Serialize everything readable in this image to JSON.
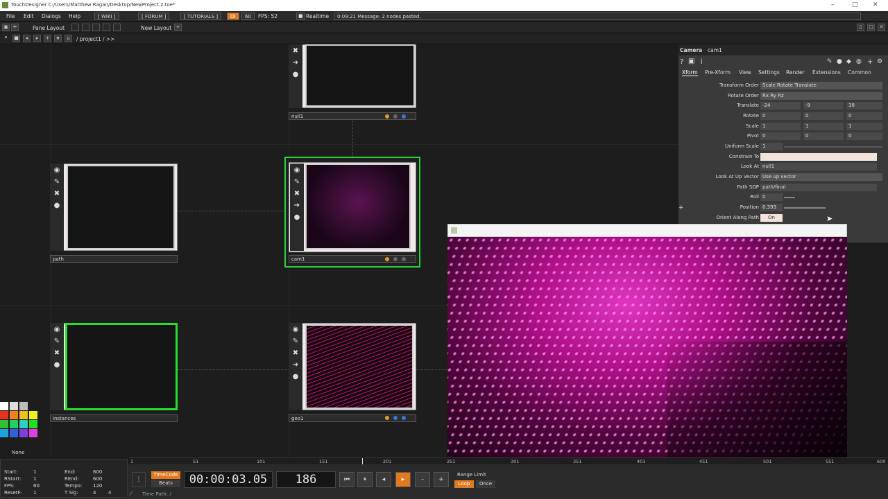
{
  "window": {
    "title": "TouchDesigner C:/Users/Matthew Ragan/Desktop/NewProject.2.toe*",
    "minimize_icon": "minimize-icon",
    "maximize_icon": "maximize-icon",
    "close_icon": "close-icon"
  },
  "menubar": {
    "items": [
      "File",
      "Edit",
      "Dialogs",
      "Help"
    ],
    "wiki": "[ WIKI ]",
    "forum": "[ FORUM ]",
    "tutorials": "[ TUTORIALS ]",
    "oi": "OI",
    "fps_cap": "60",
    "fps": "FPS: 52",
    "realtime": "Realtime",
    "message": "0:09:21 Message: 2 nodes pasted."
  },
  "toolbar": {
    "pane_layout": "Pane Layout",
    "new_layout": "New Layout",
    "path": "/ project1 / >>"
  },
  "nodes": {
    "null1": "null1",
    "path": "path",
    "cam1": "cam1",
    "instances": "instances",
    "geo1": "geo1"
  },
  "params": {
    "op_type": "Camera",
    "op_name": "cam1",
    "tabs": [
      "Xform",
      "Pre-Xform",
      "View",
      "Settings",
      "Render",
      "Extensions",
      "Common"
    ],
    "transform_order": {
      "label": "Transform Order",
      "value": "Scale Rotate Translate"
    },
    "rotate_order": {
      "label": "Rotate Order",
      "value": "Rx Ry Rz"
    },
    "translate": {
      "label": "Translate",
      "x": "-24",
      "y": "-9",
      "z": "38"
    },
    "rotate": {
      "label": "Rotate",
      "x": "0",
      "y": "0",
      "z": "0"
    },
    "scale": {
      "label": "Scale",
      "x": "1",
      "y": "1",
      "z": "1"
    },
    "pivot": {
      "label": "Pivot",
      "x": "0",
      "y": "0",
      "z": "0"
    },
    "uniform_scale": {
      "label": "Uniform Scale",
      "value": "1"
    },
    "constrain_to": {
      "label": "Constrain To",
      "value": ""
    },
    "look_at": {
      "label": "Look At",
      "value": "null1"
    },
    "look_at_up": {
      "label": "Look At Up Vector",
      "value": "Use up vector"
    },
    "path_sop": {
      "label": "Path SOP",
      "value": "path/final"
    },
    "roll": {
      "label": "Roll",
      "value": "0"
    },
    "position": {
      "label": "Position",
      "value": "0.393"
    },
    "orient": {
      "label": "Orient Along Path",
      "value": "On"
    }
  },
  "palette": {
    "none_label": "None"
  },
  "timeline": {
    "ticks": [
      "1",
      "51",
      "101",
      "151",
      "201",
      "251",
      "301",
      "351",
      "401",
      "451",
      "501",
      "551",
      "600"
    ],
    "start": {
      "label": "Start:",
      "value": "1"
    },
    "end": {
      "label": "End:",
      "value": "600"
    },
    "rstart": {
      "label": "RStart:",
      "value": "1"
    },
    "rend": {
      "label": "REnd:",
      "value": "600"
    },
    "fps": {
      "label": "FPS:",
      "value": "60"
    },
    "tempo": {
      "label": "Tempo:",
      "value": "120"
    },
    "resetf": {
      "label": "ResetF:",
      "value": "1"
    },
    "tsig": {
      "label": "T Sig:",
      "a": "4",
      "b": "4"
    },
    "timecode_label": "TimeCode",
    "beats_label": "Beats",
    "timecode": "00:00:03.05",
    "frame": "186",
    "range_limit": "Range Limit",
    "loop": "Loop",
    "once": "Once",
    "time_path": "Time Path: /"
  },
  "colors": {
    "selected_green": "#24e02c",
    "accent_orange": "#e07a1f",
    "render_magenta": "#ff3cdc"
  }
}
